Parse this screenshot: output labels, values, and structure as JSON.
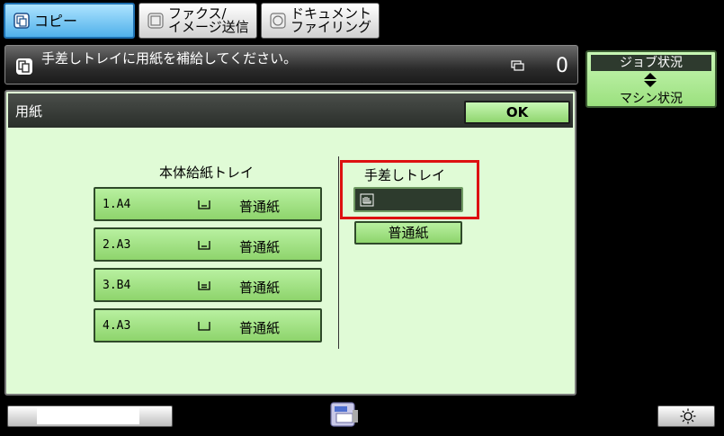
{
  "tabs": [
    {
      "label": "コピー",
      "active": true
    },
    {
      "line1": "ファクス/",
      "line2": "イメージ送信",
      "active": false
    },
    {
      "line1": "ドキュメント",
      "line2": "ファイリング",
      "active": false
    }
  ],
  "message": {
    "text": "手差しトレイに用紙を補給してください。",
    "copy_count": "0"
  },
  "job_status": {
    "top_label": "ジョブ状況",
    "bottom_label": "マシン状況"
  },
  "dialog": {
    "title": "用紙",
    "ok_label": "OK",
    "main_trays": {
      "title": "本体給紙トレイ",
      "rows": [
        {
          "name": "1.A4",
          "type": "普通紙"
        },
        {
          "name": "2.A3",
          "type": "普通紙"
        },
        {
          "name": "3.B4",
          "type": "普通紙"
        },
        {
          "name": "4.A3",
          "type": "普通紙"
        }
      ]
    },
    "bypass_tray": {
      "title": "手差しトレイ",
      "type": "普通紙"
    }
  },
  "colors": {
    "active_tab": "#4fb0ea",
    "panel_bg": "#e0fbd6",
    "button_green": "#8ed46c",
    "highlight": "#dd1111"
  },
  "icons": {
    "copy": "copy-icon",
    "bypass": "hand-icon",
    "device": "printer-icon",
    "brightness": "sun-icon"
  }
}
